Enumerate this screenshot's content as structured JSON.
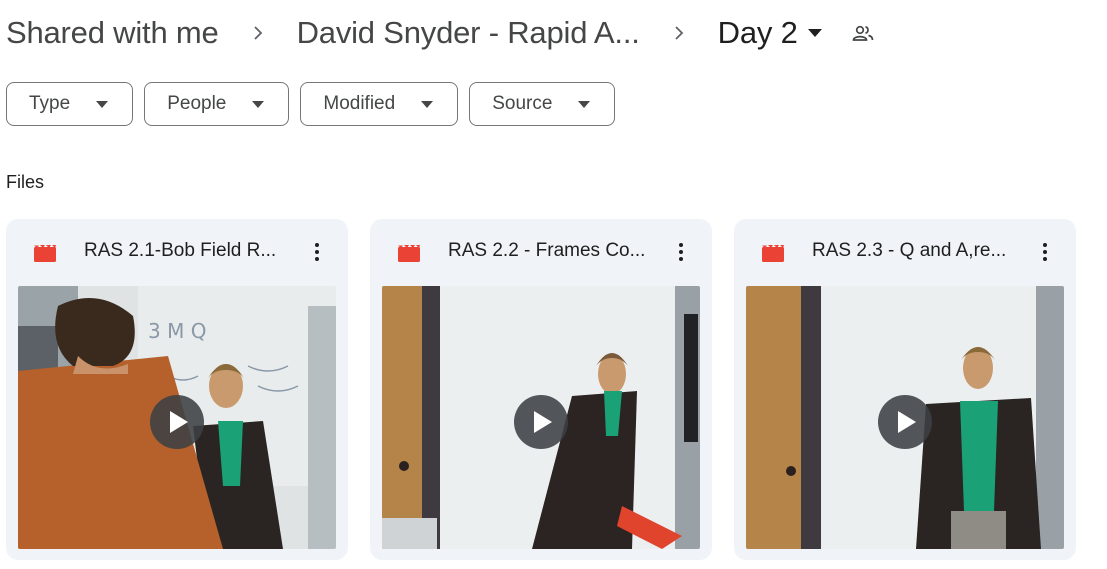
{
  "breadcrumb": {
    "items": [
      {
        "label": "Shared with me"
      },
      {
        "label": "David Snyder - Rapid A..."
      },
      {
        "label": "Day 2"
      }
    ]
  },
  "filters": [
    {
      "label": "Type"
    },
    {
      "label": "People"
    },
    {
      "label": "Modified"
    },
    {
      "label": "Source"
    }
  ],
  "section": {
    "label": "Files"
  },
  "files": [
    {
      "title": "RAS 2.1-Bob Field R...",
      "icon": "video-file-icon"
    },
    {
      "title": "RAS 2.2 - Frames Co...",
      "icon": "video-file-icon"
    },
    {
      "title": "RAS 2.3 - Q and A,re...",
      "icon": "video-file-icon"
    }
  ],
  "colors": {
    "card_bg": "#f0f4f9",
    "video_icon": "#ea4335",
    "chip_border": "#747775"
  }
}
